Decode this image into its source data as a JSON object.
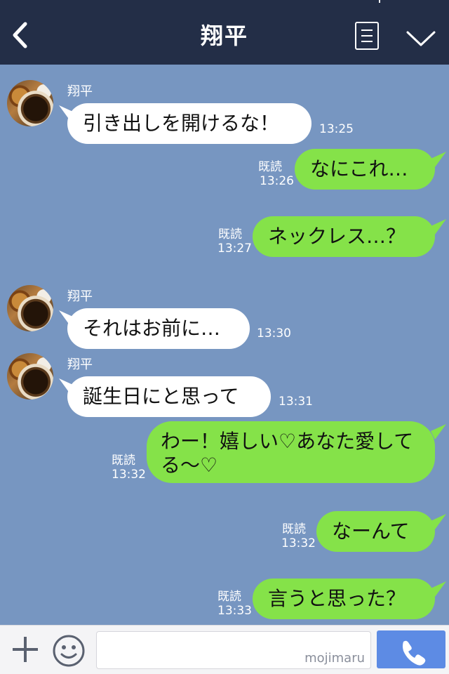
{
  "header": {
    "title": "翔平",
    "back_icon": "back-chevron-icon",
    "menu_icon": "menu-list-icon",
    "expand_icon": "chevron-down-icon"
  },
  "messages": [
    {
      "side": "left",
      "sender": "翔平",
      "text": "引き出しを開けるな！",
      "time": "13:25"
    },
    {
      "side": "right",
      "read": "既読",
      "text": "なにこれ…",
      "time": "13:26"
    },
    {
      "side": "right",
      "read": "既読",
      "text": "ネックレス…？",
      "time": "13:27"
    },
    {
      "side": "left",
      "sender": "翔平",
      "text": "それはお前に…",
      "time": "13:30"
    },
    {
      "side": "left",
      "sender": "翔平",
      "text": "誕生日にと思って",
      "time": "13:31"
    },
    {
      "side": "right",
      "read": "既読",
      "text": "わー！嬉しい♡あなた愛してる〜♡",
      "time": "13:32"
    },
    {
      "side": "right",
      "read": "既読",
      "text": "なーんて",
      "time": "13:32"
    },
    {
      "side": "right",
      "read": "既読",
      "text": "言うと思った？",
      "time": "13:33"
    }
  ],
  "input_bar": {
    "plus_icon": "plus-icon",
    "emoji_icon": "smiley-icon",
    "call_icon": "phone-icon",
    "watermark": "mojimaru"
  },
  "colors": {
    "header": "#232e47",
    "background": "#7796c1",
    "bubble_left": "#ffffff",
    "bubble_right": "#85e249",
    "call_button": "#5d8be4"
  }
}
